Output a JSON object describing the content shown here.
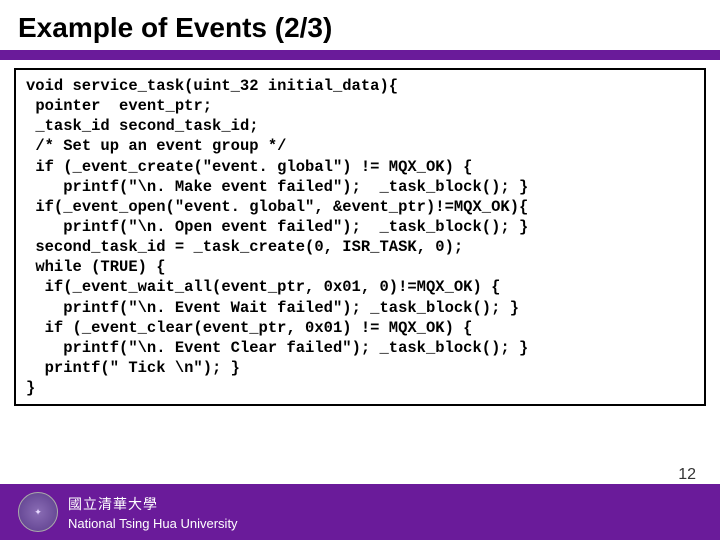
{
  "title": "Example of Events (2/3)",
  "code": "void service_task(uint_32 initial_data){\n pointer  event_ptr;\n _task_id second_task_id;\n /* Set up an event group */\n if (_event_create(\"event. global\") != MQX_OK) {\n    printf(\"\\n. Make event failed\");  _task_block(); }\n if(_event_open(\"event. global\", &event_ptr)!=MQX_OK){\n    printf(\"\\n. Open event failed\");  _task_block(); }\n second_task_id = _task_create(0, ISR_TASK, 0);\n while (TRUE) {\n  if(_event_wait_all(event_ptr, 0x01, 0)!=MQX_OK) {\n    printf(\"\\n. Event Wait failed\"); _task_block(); }\n  if (_event_clear(event_ptr, 0x01) != MQX_OK) {\n    printf(\"\\n. Event Clear failed\"); _task_block(); }\n  printf(\" Tick \\n\"); }\n}",
  "footer": {
    "university_chinese": "國立清華大學",
    "university_english": "National Tsing Hua University",
    "page_number": "12"
  }
}
